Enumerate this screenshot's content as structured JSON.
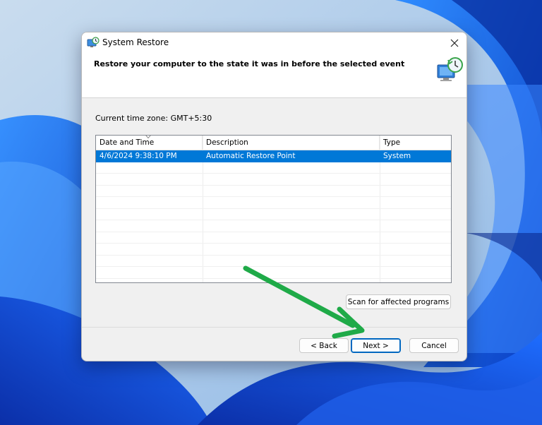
{
  "window": {
    "title": "System Restore",
    "close_icon": "close-icon",
    "app_icon": "system-restore-icon"
  },
  "header": {
    "text": "Restore your computer to the state it was in before the selected event",
    "icon": "restore-computer-icon"
  },
  "timezone_label": "Current time zone: GMT+5:30",
  "table": {
    "columns": [
      "Date and Time",
      "Description",
      "Type"
    ],
    "rows": [
      {
        "date": "4/6/2024 9:38:10 PM",
        "description": "Automatic Restore Point",
        "type": "System",
        "selected": true
      }
    ]
  },
  "buttons": {
    "scan": "Scan for affected programs",
    "back": "< Back",
    "next": "Next >",
    "cancel": "Cancel"
  },
  "colors": {
    "selection": "#0078d7",
    "annotation_arrow": "#1faa48"
  }
}
